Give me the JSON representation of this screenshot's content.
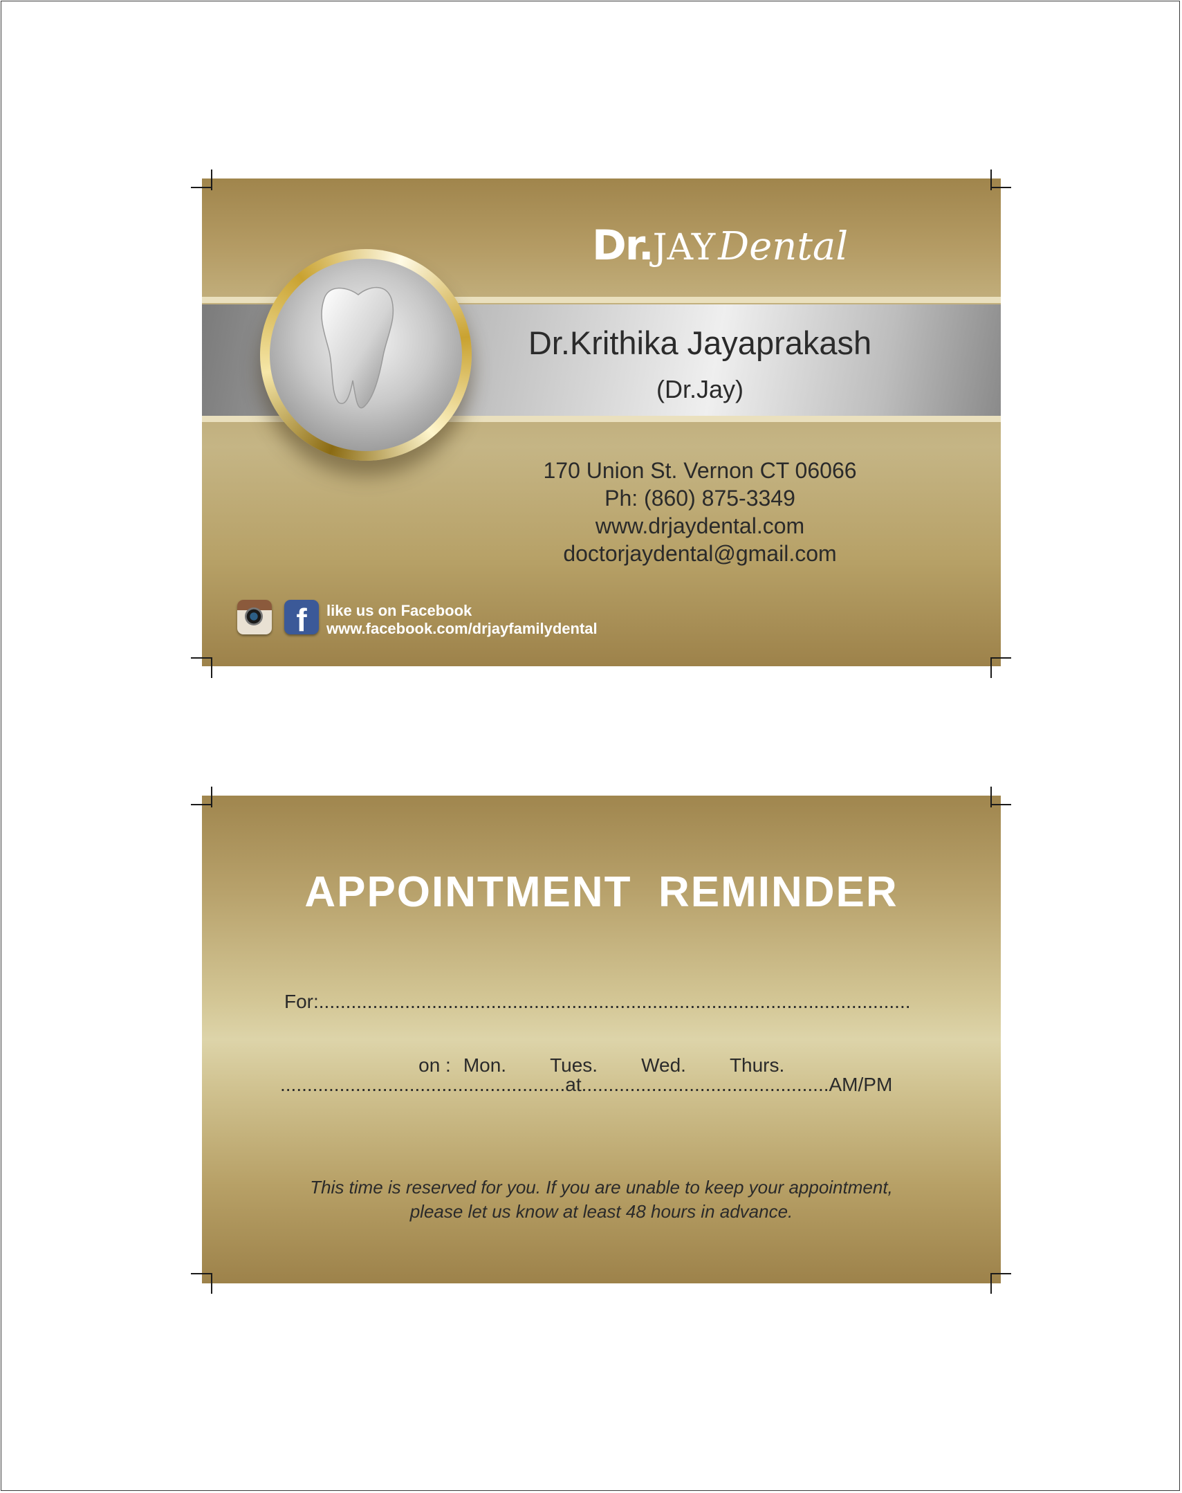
{
  "front": {
    "logo": {
      "dr": "Dr.",
      "jay": "JAY",
      "dental": "Dental"
    },
    "doctor_name": "Dr.Krithika Jayaprakash",
    "doctor_nickname": "(Dr.Jay)",
    "address": "170 Union St. Vernon CT 06066",
    "phone": "Ph: (860) 875-3349",
    "website": "www.drjaydental.com",
    "email": "doctorjaydental@gmail.com",
    "social": {
      "like_text": "like us on Facebook",
      "facebook_url": "www.facebook.com/drjayfamilydental",
      "icons": [
        "instagram-icon",
        "facebook-icon"
      ]
    },
    "colors": {
      "gold": "#b7a167",
      "silver": "#d7d7d7",
      "text": "#2b2b2b"
    }
  },
  "back": {
    "title": "APPOINTMENT  REMINDER",
    "for_line": "For:..............................................................................................................",
    "days_prefix": "on :",
    "days": [
      "Mon.",
      "Tues.",
      "Wed.",
      "Thurs."
    ],
    "time_line": ".....................................................at..............................................AM/PM",
    "note_line1": "This time is reserved for you. If you are unable to keep your appointment,",
    "note_line2": "please let us know at least 48 hours in advance."
  }
}
